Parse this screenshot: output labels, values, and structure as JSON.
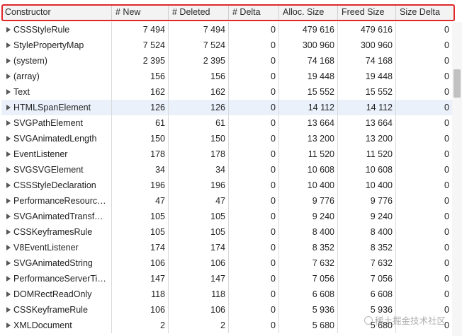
{
  "columns": [
    "Constructor",
    "# New",
    "# Deleted",
    "# Delta",
    "Alloc. Size",
    "Freed Size",
    "Size Delta"
  ],
  "rows": [
    {
      "name": "CSSStyleRule",
      "new": "7 494",
      "deleted": "7 494",
      "delta": "0",
      "alloc": "479 616",
      "freed": "479 616",
      "size_delta": "0"
    },
    {
      "name": "StylePropertyMap",
      "new": "7 524",
      "deleted": "7 524",
      "delta": "0",
      "alloc": "300 960",
      "freed": "300 960",
      "size_delta": "0"
    },
    {
      "name": "(system)",
      "new": "2 395",
      "deleted": "2 395",
      "delta": "0",
      "alloc": "74 168",
      "freed": "74 168",
      "size_delta": "0"
    },
    {
      "name": "(array)",
      "new": "156",
      "deleted": "156",
      "delta": "0",
      "alloc": "19 448",
      "freed": "19 448",
      "size_delta": "0"
    },
    {
      "name": "Text",
      "new": "162",
      "deleted": "162",
      "delta": "0",
      "alloc": "15 552",
      "freed": "15 552",
      "size_delta": "0"
    },
    {
      "name": "HTMLSpanElement",
      "new": "126",
      "deleted": "126",
      "delta": "0",
      "alloc": "14 112",
      "freed": "14 112",
      "size_delta": "0"
    },
    {
      "name": "SVGPathElement",
      "new": "61",
      "deleted": "61",
      "delta": "0",
      "alloc": "13 664",
      "freed": "13 664",
      "size_delta": "0"
    },
    {
      "name": "SVGAnimatedLength",
      "new": "150",
      "deleted": "150",
      "delta": "0",
      "alloc": "13 200",
      "freed": "13 200",
      "size_delta": "0"
    },
    {
      "name": "EventListener",
      "new": "178",
      "deleted": "178",
      "delta": "0",
      "alloc": "11 520",
      "freed": "11 520",
      "size_delta": "0"
    },
    {
      "name": "SVGSVGElement",
      "new": "34",
      "deleted": "34",
      "delta": "0",
      "alloc": "10 608",
      "freed": "10 608",
      "size_delta": "0"
    },
    {
      "name": "CSSStyleDeclaration",
      "new": "196",
      "deleted": "196",
      "delta": "0",
      "alloc": "10 400",
      "freed": "10 400",
      "size_delta": "0"
    },
    {
      "name": "PerformanceResourc…",
      "new": "47",
      "deleted": "47",
      "delta": "0",
      "alloc": "9 776",
      "freed": "9 776",
      "size_delta": "0"
    },
    {
      "name": "SVGAnimatedTransf…",
      "new": "105",
      "deleted": "105",
      "delta": "0",
      "alloc": "9 240",
      "freed": "9 240",
      "size_delta": "0"
    },
    {
      "name": "CSSKeyframesRule",
      "new": "105",
      "deleted": "105",
      "delta": "0",
      "alloc": "8 400",
      "freed": "8 400",
      "size_delta": "0"
    },
    {
      "name": "V8EventListener",
      "new": "174",
      "deleted": "174",
      "delta": "0",
      "alloc": "8 352",
      "freed": "8 352",
      "size_delta": "0"
    },
    {
      "name": "SVGAnimatedString",
      "new": "106",
      "deleted": "106",
      "delta": "0",
      "alloc": "7 632",
      "freed": "7 632",
      "size_delta": "0"
    },
    {
      "name": "PerformanceServerTi…",
      "new": "147",
      "deleted": "147",
      "delta": "0",
      "alloc": "7 056",
      "freed": "7 056",
      "size_delta": "0"
    },
    {
      "name": "DOMRectReadOnly",
      "new": "118",
      "deleted": "118",
      "delta": "0",
      "alloc": "6 608",
      "freed": "6 608",
      "size_delta": "0"
    },
    {
      "name": "CSSKeyframeRule",
      "new": "106",
      "deleted": "106",
      "delta": "0",
      "alloc": "5 936",
      "freed": "5 936",
      "size_delta": "0"
    },
    {
      "name": "XMLDocument",
      "new": "2",
      "deleted": "2",
      "delta": "0",
      "alloc": "5 680",
      "freed": "5 680",
      "size_delta": "0"
    }
  ],
  "selected_row": "HTMLSpanElement",
  "watermark": "稀土掘金技术社区",
  "colors": {
    "highlight": "#e0282b",
    "selected_row": "#eaf1fb",
    "header_bg": "#f3f3f3"
  },
  "icons": [
    "disclosure-triangle-icon"
  ]
}
